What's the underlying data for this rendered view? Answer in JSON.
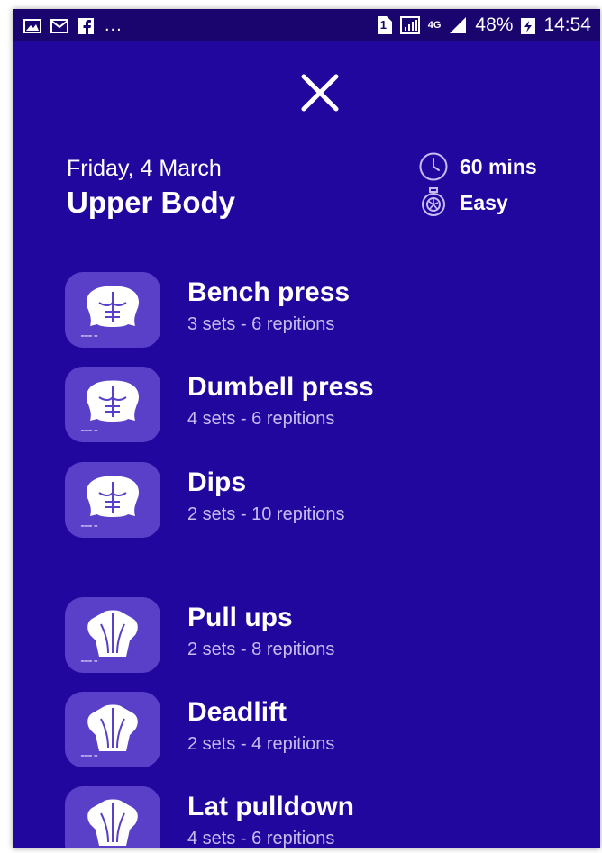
{
  "status_bar": {
    "more": "...",
    "sim_badge": "1",
    "network": "4G",
    "battery": "48%",
    "time": "14:54"
  },
  "workout": {
    "date": "Friday, 4 March",
    "title": "Upper Body",
    "duration": "60 mins",
    "difficulty": "Easy"
  },
  "exercises": [
    {
      "name": "Bench press",
      "detail": "3 sets - 6 repitions",
      "icon": "chest-muscle-icon"
    },
    {
      "name": "Dumbell press",
      "detail": "4 sets - 6 repitions",
      "icon": "chest-muscle-icon"
    },
    {
      "name": "Dips",
      "detail": "2 sets - 10 repitions",
      "icon": "chest-muscle-icon"
    },
    {
      "name": "Pull ups",
      "detail": "2 sets - 8 repitions",
      "icon": "back-muscle-icon"
    },
    {
      "name": "Deadlift",
      "detail": "2 sets - 4 repitions",
      "icon": "back-muscle-icon"
    },
    {
      "name": "Lat pulldown",
      "detail": "4 sets - 6 repitions",
      "icon": "back-muscle-icon"
    }
  ],
  "colors": {
    "background": "#22079e",
    "thumb": "#5a3fc8",
    "status_bar": "#1a056f",
    "secondary_text": "#c6bdf2"
  }
}
